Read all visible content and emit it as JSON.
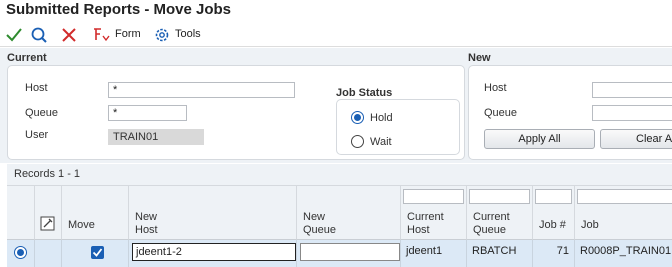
{
  "window": {
    "title": "Submitted Reports - Move Jobs"
  },
  "toolbar": {
    "ok_icon": "checkmark-icon",
    "find_icon": "search-icon",
    "cancel_icon": "close-icon",
    "form_menu": "Form",
    "tools_menu": "Tools",
    "form_icon": "form-menu-icon",
    "tools_icon": "gear-icon"
  },
  "current": {
    "section_title": "Current",
    "host_label": "Host",
    "host_value": "*",
    "queue_label": "Queue",
    "queue_value": "*",
    "user_label": "User",
    "user_value": "TRAIN01",
    "job_status": {
      "title": "Job Status",
      "options": [
        {
          "label": "Hold",
          "selected": true
        },
        {
          "label": "Wait",
          "selected": false
        }
      ]
    }
  },
  "new": {
    "section_title": "New",
    "host_label": "Host",
    "host_value": "",
    "queue_label": "Queue",
    "queue_value": "",
    "apply_all_button": "Apply All",
    "clear_all_button": "Clear A"
  },
  "records": {
    "label": "Records 1 - 1"
  },
  "grid": {
    "columns": {
      "select": "",
      "attach": "",
      "move": "Move",
      "new_host": "New\nHost",
      "new_queue": "New\nQueue",
      "current_host": "Current\nHost",
      "current_queue": "Current\nQueue",
      "job_number": "Job #",
      "job": "Job"
    },
    "rows": [
      {
        "selected": true,
        "move": true,
        "new_host": "jdeent1-2",
        "new_queue": "",
        "current_host": "jdeent1",
        "current_queue": "RBATCH",
        "job_number": "71",
        "job": "R0008P_TRAIN01"
      }
    ]
  },
  "colors": {
    "accent": "#1a5fb4",
    "ok_green": "#2e8b2e",
    "cancel_red": "#d22b2b",
    "panel": "#eef2f6"
  }
}
